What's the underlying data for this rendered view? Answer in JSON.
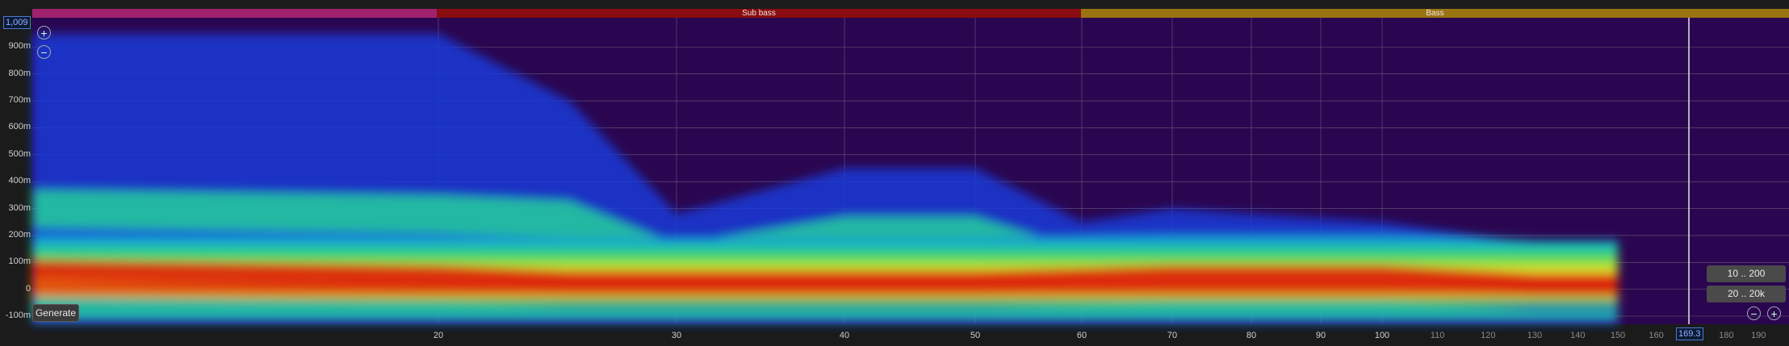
{
  "bands": {
    "sub_bass": "Sub bass",
    "bass": "Bass"
  },
  "readouts": {
    "top_value": "1,009",
    "freq_value": "169.3"
  },
  "buttons": {
    "generate": "Generate",
    "range_low": "10 .. 200",
    "range_full": "20 .. 20k"
  },
  "icons": {
    "zoom_in": "zoom-in-icon",
    "zoom_out": "zoom-out-icon"
  },
  "y_ticks": [
    "900m",
    "800m",
    "700m",
    "600m",
    "500m",
    "400m",
    "300m",
    "200m",
    "100m",
    "0",
    "-100m"
  ],
  "x_ticks": [
    "20",
    "30",
    "40",
    "50",
    "60",
    "70",
    "80",
    "90",
    "100",
    "110",
    "120",
    "130",
    "140",
    "150",
    "160",
    "180",
    "190"
  ],
  "colors": {
    "plot_bg": "#2b0650",
    "sub_bass_band": "#8a0c10",
    "bass_band": "#9b7412",
    "readout_border": "#4a7bd0"
  },
  "chart_data": {
    "type": "heatmap",
    "x_axis": "frequency (Hz), log scale",
    "y_axis": "time (s)",
    "xlim": [
      15,
      200
    ],
    "ylim": [
      -0.13,
      1.009
    ],
    "ridge": [
      {
        "x": 15,
        "peak_y": 0.07,
        "top_y": 0.95
      },
      {
        "x": 20,
        "peak_y": 0.05,
        "top_y": 0.95
      },
      {
        "x": 25,
        "peak_y": 0.03,
        "top_y": 0.7
      },
      {
        "x": 30,
        "peak_y": 0.03,
        "top_y": 0.28
      },
      {
        "x": 40,
        "peak_y": 0.03,
        "top_y": 0.45
      },
      {
        "x": 50,
        "peak_y": 0.03,
        "top_y": 0.45
      },
      {
        "x": 60,
        "peak_y": 0.04,
        "top_y": 0.25
      },
      {
        "x": 70,
        "peak_y": 0.05,
        "top_y": 0.3
      },
      {
        "x": 80,
        "peak_y": 0.05,
        "top_y": 0.28
      },
      {
        "x": 100,
        "peak_y": 0.05,
        "top_y": 0.25
      },
      {
        "x": 130,
        "peak_y": 0.02,
        "top_y": 0.17
      },
      {
        "x": 150,
        "peak_y": 0.02,
        "top_y": 0.15
      }
    ]
  }
}
